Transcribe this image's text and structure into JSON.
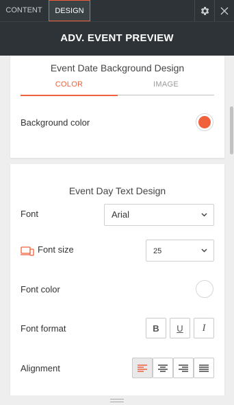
{
  "tabs": {
    "content": "CONTENT",
    "design": "DESIGN"
  },
  "header": {
    "title": "ADV. EVENT PREVIEW"
  },
  "date_background": {
    "title": "Event Date Background Design",
    "subtabs": [
      "COLOR",
      "IMAGE"
    ],
    "active_subtab": "COLOR",
    "background_label": "Background color",
    "background_color": "#f0603a"
  },
  "day_text": {
    "title": "Event Day Text Design",
    "font_label": "Font",
    "font_value": "Arial",
    "font_size_label": "Font size",
    "font_size_value": "25",
    "font_color_label": "Font color",
    "font_color_value": "#ffffff",
    "font_format_label": "Font format",
    "format_buttons": [
      "B",
      "U",
      "I"
    ],
    "alignment_label": "Alignment",
    "active_alignment": "left"
  },
  "colors": {
    "accent": "#f0603a",
    "dark": "#2d3336"
  },
  "icons": [
    "gear-icon",
    "close-icon",
    "chevron-down-icon",
    "devices-icon",
    "align-left-icon",
    "align-center-icon",
    "align-right-icon",
    "align-justify-icon",
    "resize-handle-icon"
  ]
}
